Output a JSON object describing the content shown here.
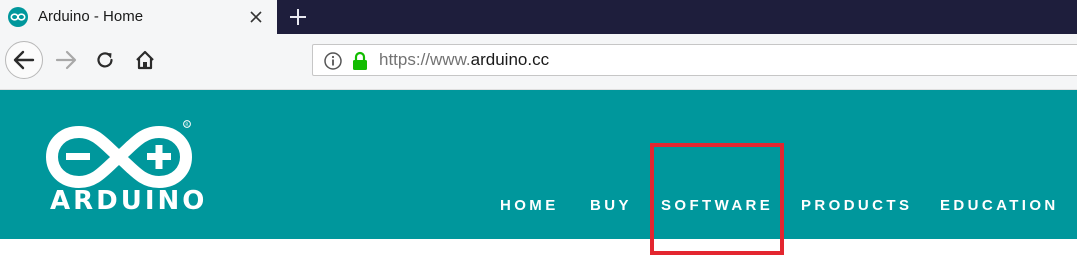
{
  "browser": {
    "tab": {
      "title": "Arduino - Home"
    },
    "url": {
      "prefix": "https://www.",
      "domain": "arduino.cc"
    }
  },
  "site": {
    "logo_text": "ARDUINO",
    "brand_color": "#00979c",
    "nav": [
      {
        "label": "HOME"
      },
      {
        "label": "BUY"
      },
      {
        "label": "SOFTWARE"
      },
      {
        "label": "PRODUCTS"
      },
      {
        "label": "EDUCATION"
      }
    ]
  },
  "annotation": {
    "highlight_color": "#e3262f",
    "highlighted_item": "SOFTWARE"
  }
}
